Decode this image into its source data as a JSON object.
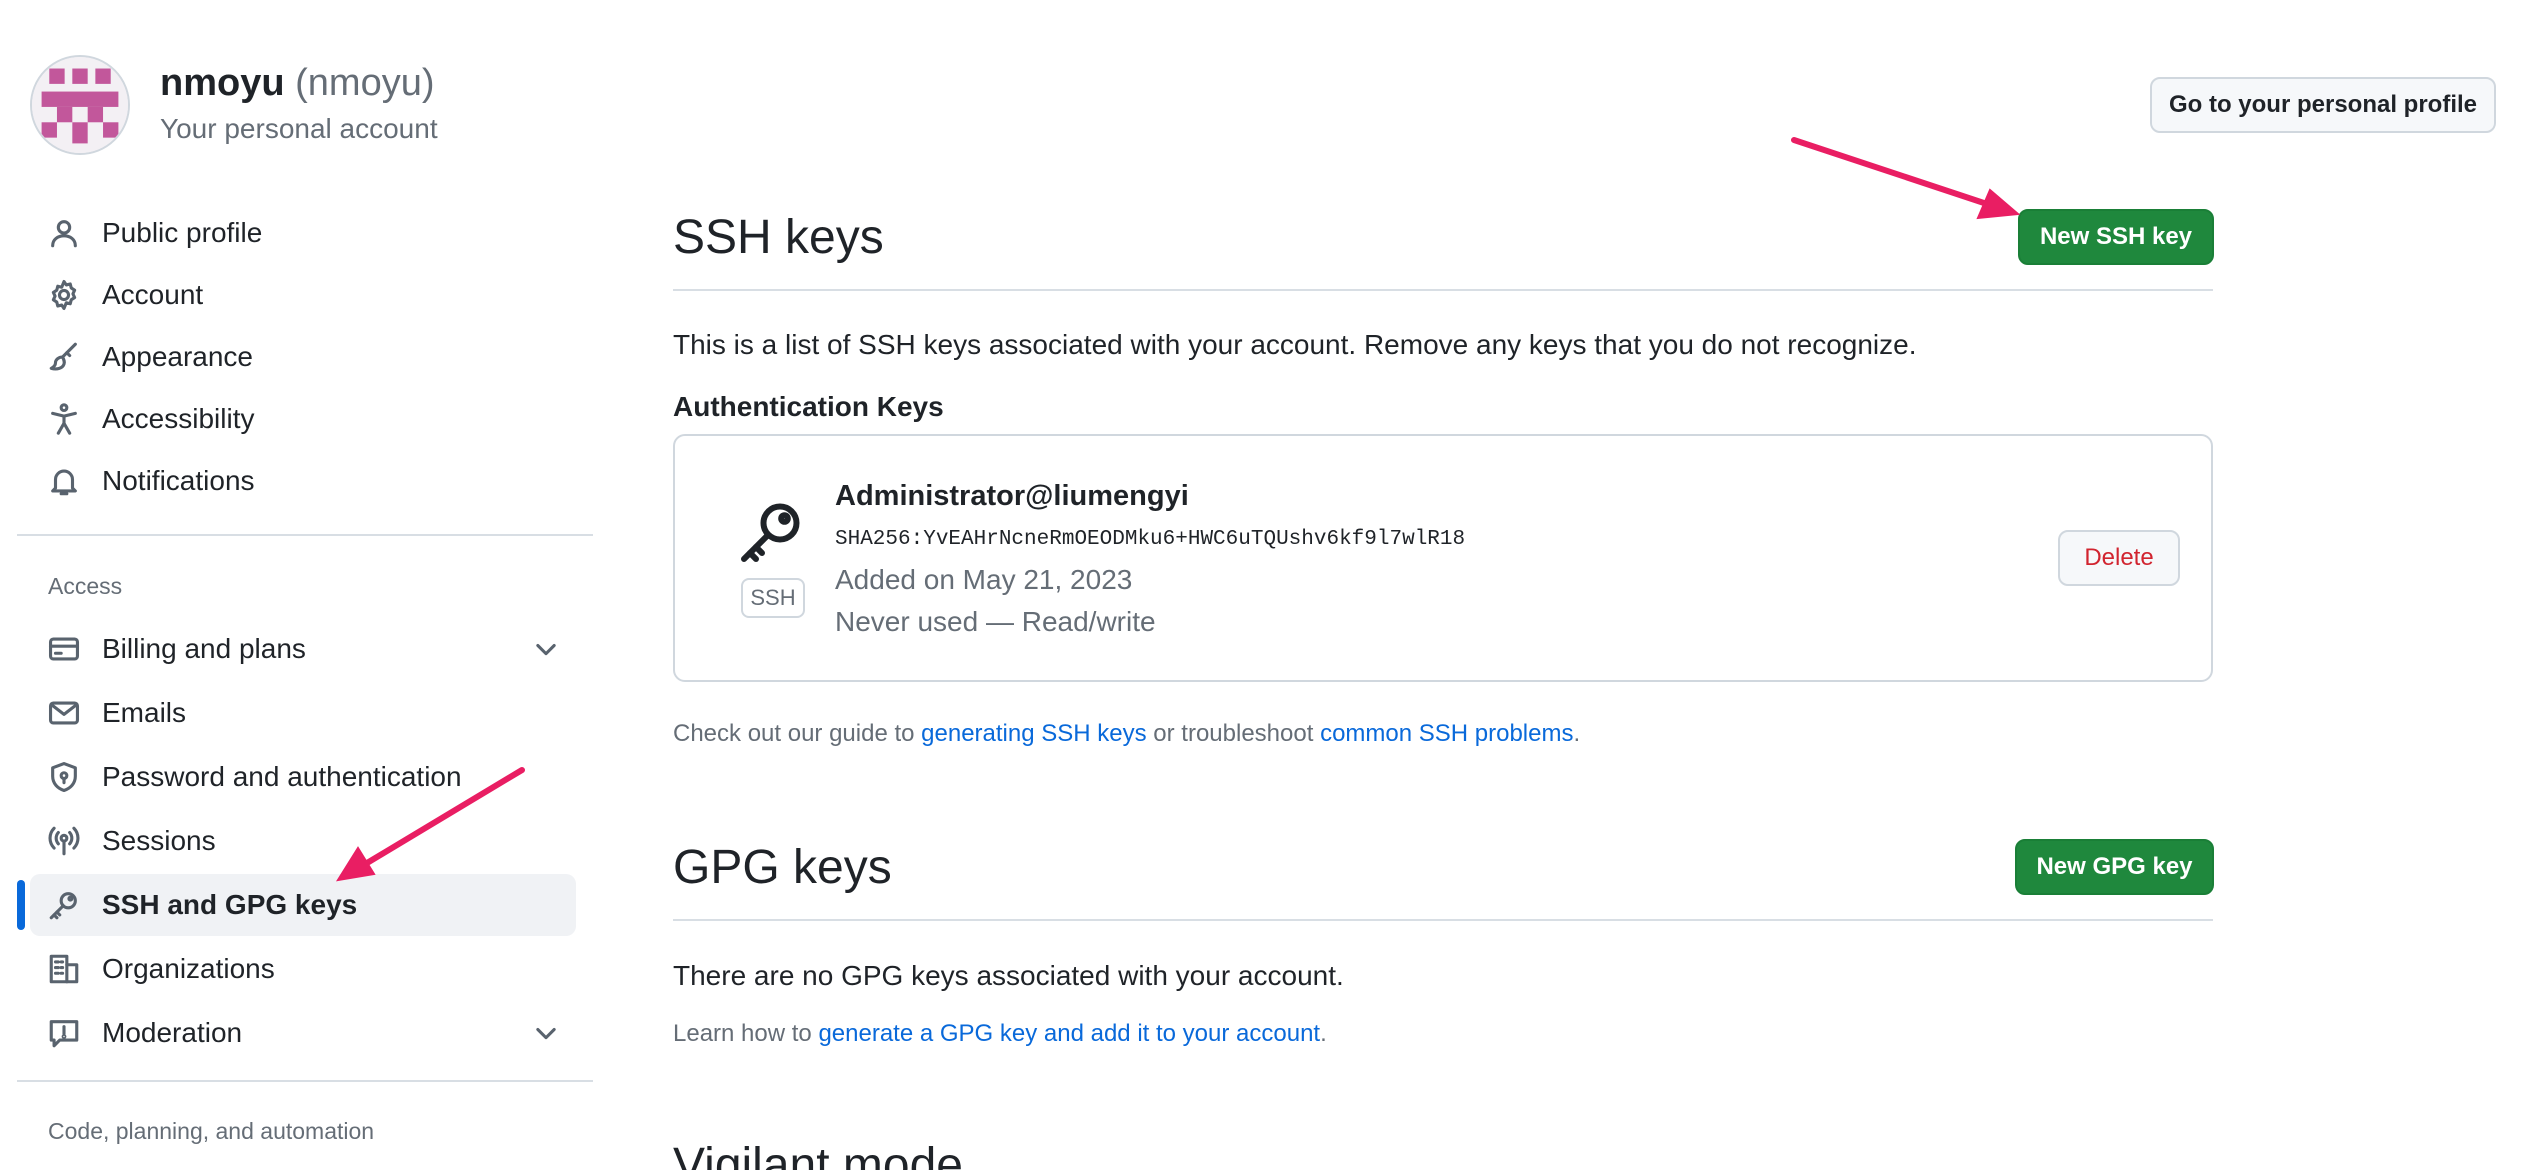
{
  "account": {
    "name": "nmoyu",
    "login": "(nmoyu)",
    "subtitle": "Your personal account",
    "profile_button": "Go to your personal profile"
  },
  "sidebar": {
    "items": [
      {
        "label": "Public profile",
        "icon": "person-icon"
      },
      {
        "label": "Account",
        "icon": "gear-icon"
      },
      {
        "label": "Appearance",
        "icon": "paintbrush-icon"
      },
      {
        "label": "Accessibility",
        "icon": "accessibility-icon"
      },
      {
        "label": "Notifications",
        "icon": "bell-icon"
      }
    ],
    "access_heading": "Access",
    "access_items": [
      {
        "label": "Billing and plans",
        "icon": "credit-card-icon",
        "expandable": true
      },
      {
        "label": "Emails",
        "icon": "mail-icon"
      },
      {
        "label": "Password and authentication",
        "icon": "shield-lock-icon"
      },
      {
        "label": "Sessions",
        "icon": "broadcast-icon"
      },
      {
        "label": "SSH and GPG keys",
        "icon": "key-icon",
        "active": true
      },
      {
        "label": "Organizations",
        "icon": "organization-icon"
      },
      {
        "label": "Moderation",
        "icon": "report-icon",
        "expandable": true
      }
    ],
    "code_heading": "Code, planning, and automation"
  },
  "ssh": {
    "title": "SSH keys",
    "new_button": "New SSH key",
    "description": "This is a list of SSH keys associated with your account. Remove any keys that you do not recognize.",
    "auth_heading": "Authentication Keys",
    "key": {
      "badge": "SSH",
      "title": "Administrator@liumengyi",
      "fingerprint": "SHA256:YvEAHrNcneRmOEODMku6+HWC6uTQUshv6kf9l7wlR18",
      "added": "Added on May 21, 2023",
      "usage": "Never used — Read/write",
      "delete_button": "Delete"
    },
    "guide_prefix": "Check out our guide to ",
    "guide_link1": "generating SSH keys",
    "guide_middle": " or troubleshoot ",
    "guide_link2": "common SSH problems",
    "guide_suffix": "."
  },
  "gpg": {
    "title": "GPG keys",
    "new_button": "New GPG key",
    "empty": "There are no GPG keys associated with your account.",
    "learn_prefix": "Learn how to ",
    "learn_link": "generate a GPG key and add it to your account",
    "learn_suffix": "."
  },
  "vigilant": {
    "title": "Vigilant mode"
  },
  "colors": {
    "accent": "#0969da",
    "primary_button": "#1f883d",
    "danger": "#d1242f",
    "annotation_arrow": "#e91e63"
  }
}
